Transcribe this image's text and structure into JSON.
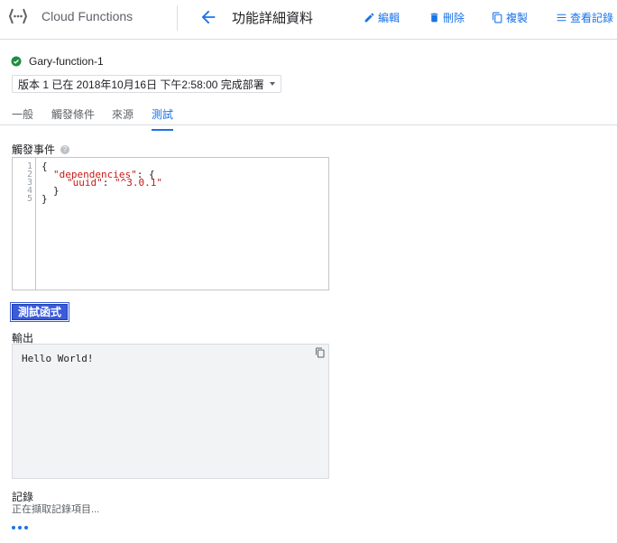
{
  "header": {
    "product_name": "Cloud Functions",
    "page_title": "功能詳細資料",
    "actions": [
      {
        "label": "編輯",
        "icon": "pencil-icon"
      },
      {
        "label": "刪除",
        "icon": "trash-icon"
      },
      {
        "label": "複製",
        "icon": "copy-icon"
      },
      {
        "label": "查看記錄",
        "icon": "list-icon"
      }
    ]
  },
  "function": {
    "name": "Gary-function-1",
    "status": "deployed",
    "status_color": "#1e8e3e",
    "version_label": "版本 1 已在 2018年10月16日 下午2:58:00 完成部署"
  },
  "tabs": [
    {
      "label": "一般",
      "active": false
    },
    {
      "label": "觸發條件",
      "active": false
    },
    {
      "label": "來源",
      "active": false
    },
    {
      "label": "測試",
      "active": true
    }
  ],
  "trigger_event": {
    "label": "觸發事件",
    "line_numbers": [
      "1",
      "2",
      "3",
      "4",
      "5"
    ],
    "code": {
      "line1": "{",
      "line2_key": "\"dependencies\"",
      "line2_rest": ": {",
      "line3_key": "\"uuid\"",
      "line3_sep": ": ",
      "line3_val": "\"^3.0.1\"",
      "line4": "}",
      "line5": "}"
    }
  },
  "test_button_label": "測試函式",
  "output": {
    "label": "輸出",
    "text": "Hello World!"
  },
  "logs": {
    "label": "記錄",
    "status": "正在擷取記錄項目..."
  },
  "colors": {
    "accent": "#1a73e8",
    "button": "#3b5bdb",
    "json_string": "#c41a16"
  }
}
